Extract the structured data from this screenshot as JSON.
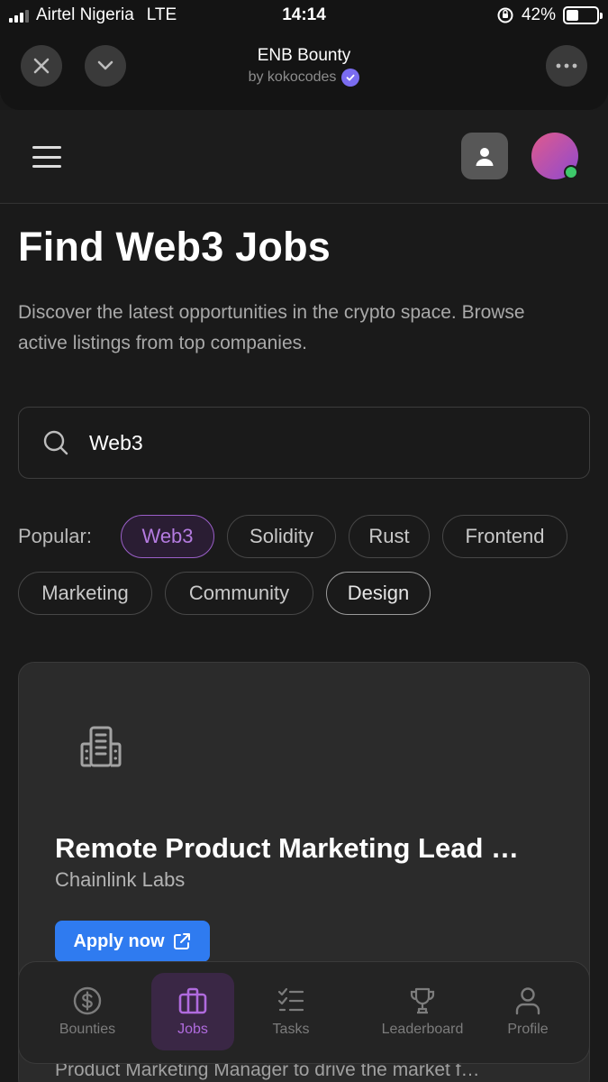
{
  "status_bar": {
    "carrier": "Airtel Nigeria",
    "network": "LTE",
    "time": "14:14",
    "battery_percent": "42%",
    "battery_level": 0.42
  },
  "mini_app": {
    "title": "ENB Bounty",
    "author": "by kokocodes",
    "icons": [
      "close-icon",
      "chevron-down-icon",
      "more-icon"
    ]
  },
  "hero": {
    "title": "Find Web3 Jobs",
    "description": "Discover the latest opportunities in the crypto space. Browse active listings from top companies."
  },
  "search": {
    "value": "Web3",
    "placeholder": ""
  },
  "popular": {
    "label": "Popular:",
    "tags": [
      "Web3",
      "Solidity",
      "Rust",
      "Frontend",
      "Marketing",
      "Community",
      "Design"
    ],
    "active": "Web3"
  },
  "job": {
    "title": "Remote Product Marketing Lead …",
    "company": "Chainlink Labs",
    "apply_label": "Apply now",
    "description": "Product Marketing Manager to drive the market f…"
  },
  "bottom_nav": {
    "items": [
      {
        "label": "Bounties",
        "icon": "dollar-icon"
      },
      {
        "label": "Jobs",
        "icon": "briefcase-icon"
      },
      {
        "label": "Tasks",
        "icon": "tasks-icon"
      },
      {
        "label": "Leaderboard",
        "icon": "trophy-icon"
      },
      {
        "label": "Profile",
        "icon": "user-icon"
      }
    ],
    "active": "Jobs"
  },
  "colors": {
    "accent_purple": "#b06bde",
    "apply_blue": "#2f7bf0",
    "online_green": "#3ec96b"
  }
}
